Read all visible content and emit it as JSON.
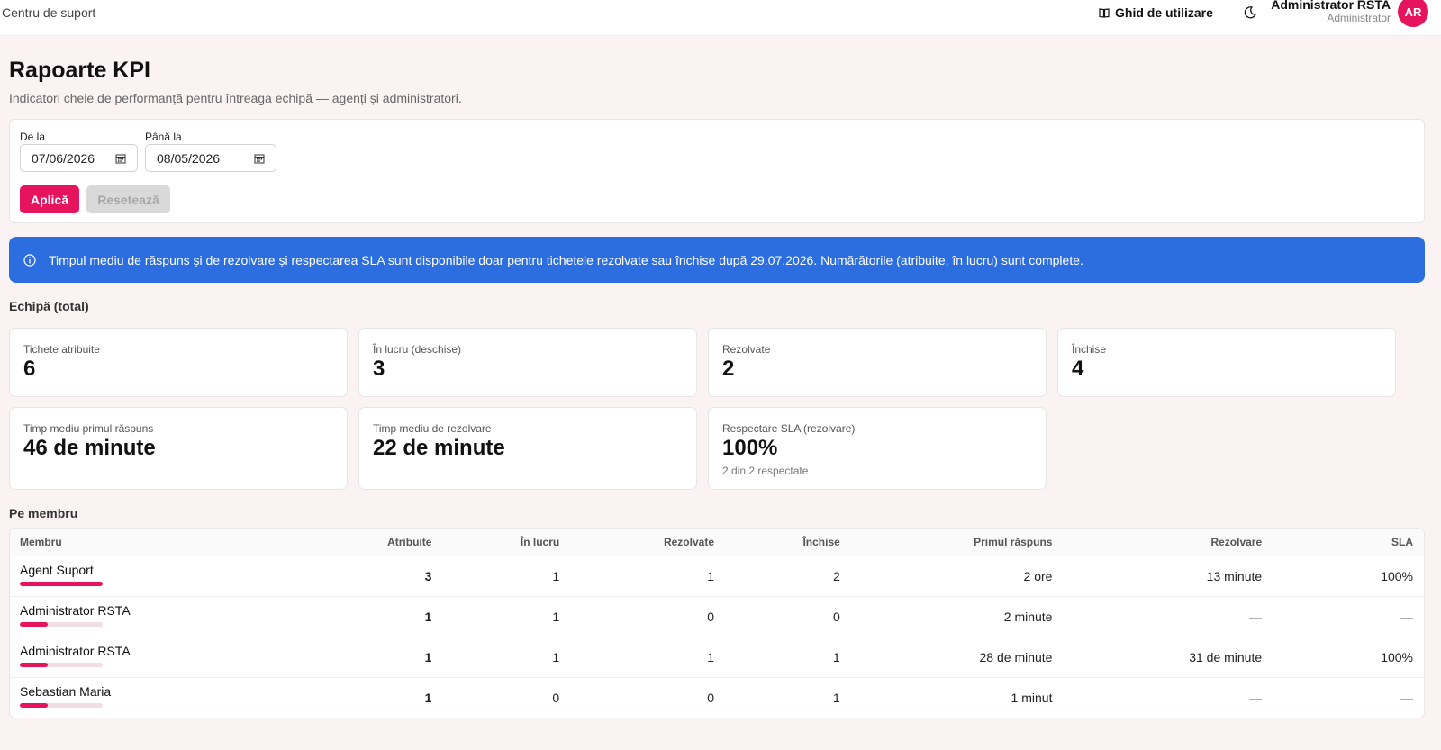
{
  "header": {
    "brand": "Centru de suport",
    "guide_label": "Ghid de utilizare",
    "user_name": "Administrator RSTA",
    "user_role": "Administrator",
    "avatar_initials": "AR"
  },
  "page": {
    "title": "Rapoarte KPI",
    "subtitle": "Indicatori cheie de performanță pentru întreaga echipă — agenți și administratori."
  },
  "filters": {
    "from_label": "De la",
    "from_value": "07/06/2026",
    "to_label": "Până la",
    "to_value": "08/05/2026",
    "apply_label": "Aplică",
    "reset_label": "Resetează"
  },
  "banner": {
    "text": "Timpul mediu de răspuns și de rezolvare și respectarea SLA sunt disponibile doar pentru tichetele rezolvate sau închise după 29.07.2026. Numărătorile (atribuite, în lucru) sunt complete."
  },
  "team": {
    "section_title": "Echipă (total)",
    "kpis": [
      {
        "label": "Tichete atribuite",
        "value": "6"
      },
      {
        "label": "În lucru (deschise)",
        "value": "3"
      },
      {
        "label": "Rezolvate",
        "value": "2"
      },
      {
        "label": "Închise",
        "value": "4"
      },
      {
        "label": "Timp mediu primul răspuns",
        "value": "46 de minute"
      },
      {
        "label": "Timp mediu de rezolvare",
        "value": "22 de minute"
      },
      {
        "label": "Respectare SLA (rezolvare)",
        "value": "100%",
        "sub": "2 din 2 respectate"
      }
    ]
  },
  "members": {
    "section_title": "Pe membru",
    "columns": [
      "Membru",
      "Atribuite",
      "În lucru",
      "Rezolvate",
      "Închise",
      "Primul răspuns",
      "Rezolvare",
      "SLA"
    ],
    "rows": [
      {
        "name": "Agent Suport",
        "share": 1.0,
        "assigned": "3",
        "in_progress": "1",
        "resolved": "1",
        "closed": "2",
        "first_response": "2 ore",
        "resolution": "13 minute",
        "sla": "100%"
      },
      {
        "name": "Administrator RSTA",
        "share": 0.333,
        "assigned": "1",
        "in_progress": "1",
        "resolved": "0",
        "closed": "0",
        "first_response": "2 minute",
        "resolution": "—",
        "sla": "—"
      },
      {
        "name": "Administrator RSTA",
        "share": 0.333,
        "assigned": "1",
        "in_progress": "1",
        "resolved": "1",
        "closed": "1",
        "first_response": "28 de minute",
        "resolution": "31 de minute",
        "sla": "100%"
      },
      {
        "name": "Sebastian Maria",
        "share": 0.333,
        "assigned": "1",
        "in_progress": "0",
        "resolved": "0",
        "closed": "1",
        "first_response": "1 minut",
        "resolution": "—",
        "sla": "—"
      }
    ]
  },
  "colors": {
    "accent": "#e5145c",
    "banner": "#2c6ee0",
    "background": "#fbf2f4"
  }
}
